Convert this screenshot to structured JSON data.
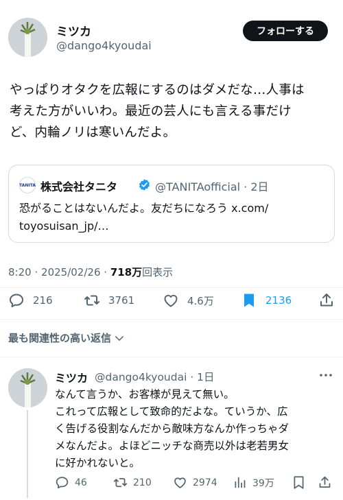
{
  "tweet": {
    "author_name": "ミツカ",
    "author_handle": "@dango4kyoudai",
    "follow_label": "フォローする",
    "text": "やっぱりオタクを広報にするのはダメだな…人事は\n考えた方がいいわ。最近の芸人にも言える事だけ\nど、内輪ノリは寒いんだよ。",
    "time": "8:20",
    "date": "2025/02/26",
    "views_count": "718万",
    "views_label": "回表示",
    "separator": "·"
  },
  "quote": {
    "logo_text": "TANITA",
    "name": "株式会社タニタ",
    "handle_time": "@TANITAofficial · 2日",
    "text": "恐がることはないんだよ。友だちになろう x.com/\ntoyosuisan_jp/…"
  },
  "actions": {
    "replies": "216",
    "retweets": "3761",
    "likes": "4.6万",
    "bookmarks": "2136"
  },
  "sort": {
    "label": "最も関連性の高い返信"
  },
  "reply": {
    "author_name": "ミツカ",
    "handle_time": "@dango4kyoudai · 1日",
    "text": "なんて言うか、お客様が見えて無い。\nこれって広報として致命的だよな。ていうか、広\nく告げる役割なんだから敵味方なんか作っちゃダ\nメなんだよ。よほどニッチな商売以外は老若男女\nに好かれないと。",
    "replies": "46",
    "retweets": "210",
    "likes": "2974",
    "views": "39万"
  },
  "colors": {
    "text": "#0f1419",
    "secondary": "#536471",
    "accent": "#1d9bf0",
    "border": "#cfd9de"
  },
  "icons": [
    "reply-icon",
    "retweet-icon",
    "like-icon",
    "bookmark-icon",
    "share-icon",
    "verified-icon",
    "chevron-down-icon",
    "more-icon",
    "views-icon"
  ]
}
